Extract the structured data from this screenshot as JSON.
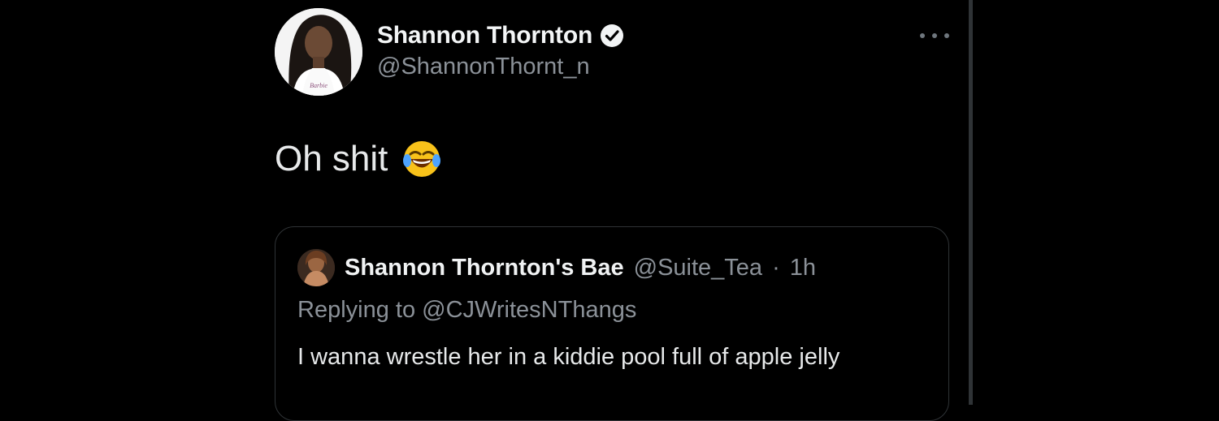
{
  "theme": {
    "background": "#000000",
    "text": "#e7e9ea",
    "secondary_text": "#8b9198",
    "border": "#2f3336"
  },
  "tweet": {
    "author_name": "Shannon Thornton",
    "author_handle": "@ShannonThornt_n",
    "verified_icon": "verified-badge-icon",
    "more_icon": "more-options-icon",
    "text": "Oh shit",
    "emoji": "face-with-tears-of-joy-icon"
  },
  "quote": {
    "author_name": "Shannon Thornton's Bae",
    "author_handle": "@Suite_Tea",
    "separator": "·",
    "time": "1h",
    "replying_to": "Replying to @CJWritesNThangs",
    "text": "I wanna wrestle her in a kiddie pool full of apple jelly"
  }
}
